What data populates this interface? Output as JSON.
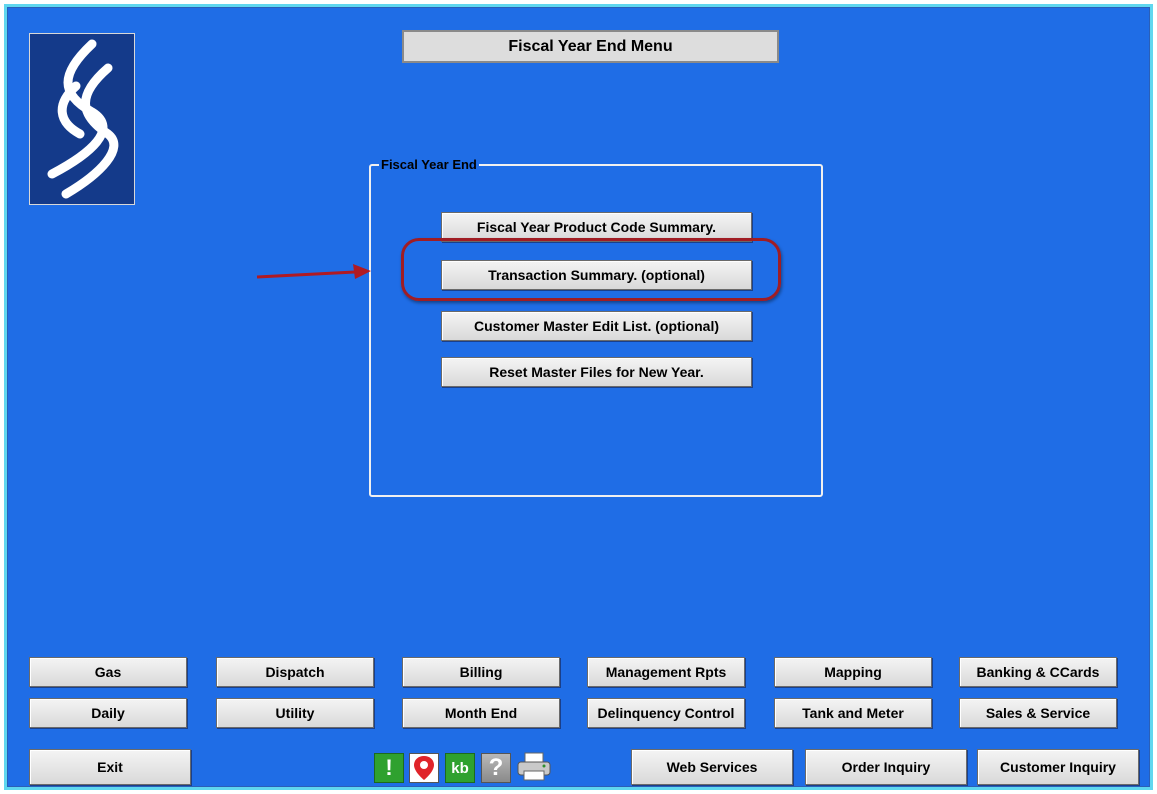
{
  "window": {
    "title": "Fiscal Year End Menu"
  },
  "group": {
    "label": "Fiscal Year End",
    "buttons": [
      "Fiscal Year Product Code Summary.",
      "Transaction Summary. (optional)",
      "Customer Master Edit List. (optional)",
      "Reset Master Files for New Year."
    ]
  },
  "nav": {
    "row1": [
      "Gas",
      "Dispatch",
      "Billing",
      "Management Rpts",
      "Mapping",
      "Banking & CCards"
    ],
    "row2": [
      "Daily",
      "Utility",
      "Month End",
      "Delinquency Control",
      "Tank and Meter",
      "Sales & Service"
    ]
  },
  "bottom": {
    "exit": "Exit",
    "icons": [
      "alert-icon",
      "map-pin-icon",
      "kb-icon",
      "help-icon",
      "printer-icon"
    ],
    "icon_glyphs": {
      "alert": "!",
      "kb": "kb",
      "help": "?"
    },
    "web_services": "Web Services",
    "order_inquiry": "Order Inquiry",
    "customer_inquiry": "Customer Inquiry"
  },
  "colors": {
    "background": "#1f6de6",
    "frame_border": "#5fd7ef",
    "highlight": "#a01d24",
    "alert_green": "#2fa12f",
    "pin_red": "#e0242a"
  }
}
